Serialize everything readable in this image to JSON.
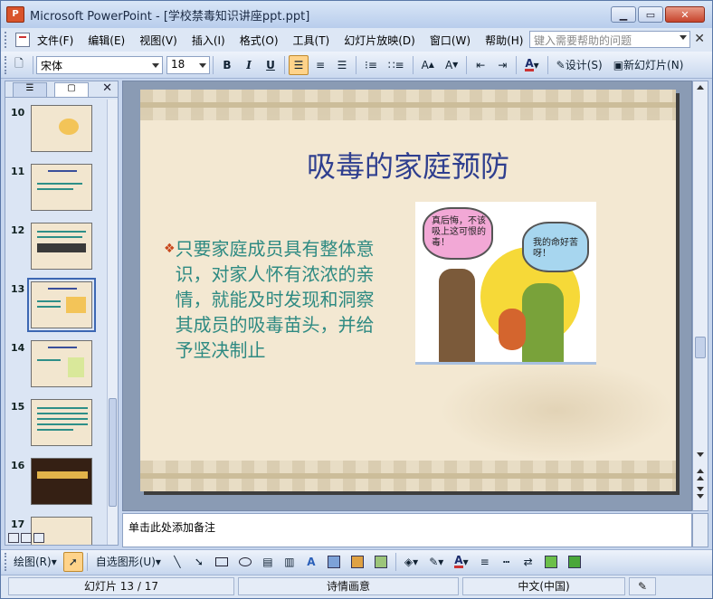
{
  "window": {
    "title": "Microsoft PowerPoint - [学校禁毒知识讲座ppt.ppt]",
    "app_icon_label": "P"
  },
  "menubar": {
    "items": [
      "文件(F)",
      "编辑(E)",
      "视图(V)",
      "插入(I)",
      "格式(O)",
      "工具(T)",
      "幻灯片放映(D)",
      "窗口(W)",
      "帮助(H)"
    ],
    "help_placeholder": "键入需要帮助的问题"
  },
  "toolbar": {
    "font_name": "宋体",
    "font_size": "18",
    "bold": "B",
    "italic": "I",
    "underline": "U",
    "design_label": "设计(S)",
    "new_slide_label": "新幻灯片(N)"
  },
  "slides_pane": {
    "numbers": [
      "10",
      "11",
      "12",
      "13",
      "14",
      "15",
      "16",
      "17"
    ],
    "selected": "13"
  },
  "slide": {
    "title": "吸毒的家庭预防",
    "bullet": "只要家庭成员具有整体意识，对家人怀有浓浓的亲情，就能及时发现和洞察其成员的吸毒苗头，并给予坚决制止",
    "bubble_left": "真后悔，不该吸上这可恨的毒！",
    "bubble_right": "我的命好苦呀！"
  },
  "notes": {
    "placeholder": "单击此处添加备注"
  },
  "drawing_toolbar": {
    "draw_label": "绘图(R)",
    "autoshapes_label": "自选图形(U)"
  },
  "statusbar": {
    "slide_position": "幻灯片 13 / 17",
    "design_name": "诗情画意",
    "language": "中文(中国)"
  },
  "colors": {
    "title": "#2f3f8f",
    "body_text": "#2e8a82",
    "bullet": "#c8471c",
    "background": "#f3e8d2"
  }
}
